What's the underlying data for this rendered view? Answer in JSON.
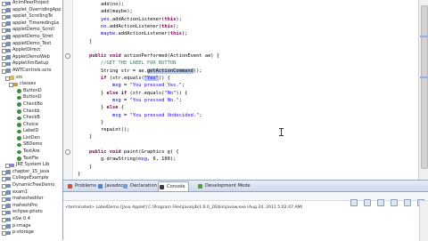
{
  "explorer": {
    "items": [
      {
        "label": "AnimPeerProject",
        "indent": 0,
        "icon": "project"
      },
      {
        "label": "applet_OverridingApp",
        "indent": 0,
        "icon": "project"
      },
      {
        "label": "applet_ScrollingTe",
        "indent": 0,
        "icon": "project"
      },
      {
        "label": "applet_TimeredingLe",
        "indent": 0,
        "icon": "project"
      },
      {
        "label": "appletDemo_Scroll",
        "indent": 0,
        "icon": "project"
      },
      {
        "label": "appletDemo_Stret",
        "indent": 0,
        "icon": "project"
      },
      {
        "label": "appletDemo_Text",
        "indent": 0,
        "icon": "project"
      },
      {
        "label": "AppletDirect",
        "indent": 0,
        "icon": "project"
      },
      {
        "label": "AppletDemoWeb",
        "indent": 0,
        "icon": "project"
      },
      {
        "label": "AppletXmlSetup",
        "indent": 0,
        "icon": "project"
      },
      {
        "label": "AWTControls.scro",
        "indent": 0,
        "icon": "project"
      },
      {
        "label": "src",
        "indent": 1,
        "icon": "folder"
      },
      {
        "label": "classes",
        "indent": 2,
        "icon": "package"
      },
      {
        "label": "ButtonD",
        "indent": 3,
        "icon": "classfile"
      },
      {
        "label": "ButtonD",
        "indent": 3,
        "icon": "classfile"
      },
      {
        "label": "CheckBo",
        "indent": 3,
        "icon": "classfile"
      },
      {
        "label": "Checkb",
        "indent": 3,
        "icon": "classfile"
      },
      {
        "label": "CheckB",
        "indent": 3,
        "icon": "classfile"
      },
      {
        "label": "Choice",
        "indent": 3,
        "icon": "classfile"
      },
      {
        "label": "LabelD",
        "indent": 3,
        "icon": "classfile"
      },
      {
        "label": "ListDen",
        "indent": 3,
        "icon": "classfile"
      },
      {
        "label": "SBDemo",
        "indent": 3,
        "icon": "classfile"
      },
      {
        "label": "TextAre",
        "indent": 3,
        "icon": "classfile"
      },
      {
        "label": "TextFie",
        "indent": 3,
        "icon": "classfile"
      },
      {
        "label": "JRE System Lib",
        "indent": 1,
        "icon": "lib"
      },
      {
        "label": "chapter_15_java",
        "indent": 0,
        "icon": "project"
      },
      {
        "label": "CollegeExample",
        "indent": 0,
        "icon": "project"
      },
      {
        "label": "DynamicTreeDemo",
        "indent": 0,
        "icon": "project"
      },
      {
        "label": "exam1",
        "indent": 0,
        "icon": "project"
      },
      {
        "label": "mahesheditor",
        "indent": 0,
        "icon": "project"
      },
      {
        "label": "maheshPro",
        "indent": 0,
        "icon": "project"
      },
      {
        "label": "eclipse-photo",
        "indent": 0,
        "icon": "project"
      },
      {
        "label": "eSw 0.4",
        "indent": 0,
        "icon": "project"
      },
      {
        "label": "p-image",
        "indent": 0,
        "icon": "project"
      },
      {
        "label": "p-storage",
        "indent": 0,
        "icon": "project"
      }
    ]
  },
  "editor": {
    "lines": [
      {
        "indent": 2,
        "parts": [
          {
            "t": "add(no);",
            "c": ""
          }
        ]
      },
      {
        "indent": 2,
        "parts": [
          {
            "t": "add(maybe);",
            "c": ""
          }
        ]
      },
      {
        "indent": 2,
        "parts": [
          {
            "t": "yes",
            "c": "fld"
          },
          {
            "t": ".addActionListener(",
            "c": ""
          },
          {
            "t": "this",
            "c": "kw"
          },
          {
            "t": ");",
            "c": ""
          }
        ]
      },
      {
        "indent": 2,
        "parts": [
          {
            "t": "no",
            "c": "fld"
          },
          {
            "t": ".addActionListener(",
            "c": ""
          },
          {
            "t": "this",
            "c": "kw"
          },
          {
            "t": ");",
            "c": ""
          }
        ]
      },
      {
        "indent": 2,
        "parts": [
          {
            "t": "maybe",
            "c": "fld"
          },
          {
            "t": ".addActionListener(",
            "c": ""
          },
          {
            "t": "this",
            "c": "kw"
          },
          {
            "t": ");",
            "c": ""
          }
        ]
      },
      {
        "indent": 1,
        "parts": [
          {
            "t": "}",
            "c": ""
          }
        ]
      },
      {
        "indent": 0,
        "parts": []
      },
      {
        "indent": 1,
        "parts": [
          {
            "t": "public void",
            "c": "kw"
          },
          {
            "t": " actionPerformed(ActionEvent ae) {",
            "c": ""
          }
        ]
      },
      {
        "indent": 2,
        "parts": [
          {
            "t": "//GET THE LABEL FOR BUTTON",
            "c": "cmt"
          }
        ]
      },
      {
        "indent": 2,
        "parts": [
          {
            "t": "String str = ae.",
            "c": ""
          },
          {
            "t": "getActionCommand",
            "c": "hl"
          },
          {
            "t": "();",
            "c": ""
          }
        ]
      },
      {
        "indent": 2,
        "parts": [
          {
            "t": "if",
            "c": "kw"
          },
          {
            "t": " (str.equals(",
            "c": ""
          },
          {
            "t": "\"Yes\"",
            "c": "str hl"
          },
          {
            "t": ")) {",
            "c": ""
          }
        ]
      },
      {
        "indent": 3,
        "parts": [
          {
            "t": "msg",
            "c": "fld"
          },
          {
            "t": " = ",
            "c": ""
          },
          {
            "t": "\"You pressed Yes.\"",
            "c": "str"
          },
          {
            "t": ";",
            "c": ""
          }
        ]
      },
      {
        "indent": 2,
        "parts": [
          {
            "t": "} ",
            "c": ""
          },
          {
            "t": "else if",
            "c": "kw"
          },
          {
            "t": " (str.equals(",
            "c": ""
          },
          {
            "t": "\"No\"",
            "c": "str"
          },
          {
            "t": ")) {",
            "c": ""
          }
        ]
      },
      {
        "indent": 3,
        "parts": [
          {
            "t": "msg",
            "c": "fld"
          },
          {
            "t": " = ",
            "c": ""
          },
          {
            "t": "\"You pressed No.\"",
            "c": "str"
          },
          {
            "t": ";",
            "c": ""
          }
        ]
      },
      {
        "indent": 2,
        "parts": [
          {
            "t": "} ",
            "c": ""
          },
          {
            "t": "else",
            "c": "kw"
          },
          {
            "t": " {",
            "c": ""
          }
        ]
      },
      {
        "indent": 3,
        "parts": [
          {
            "t": "msg",
            "c": "fld"
          },
          {
            "t": " = ",
            "c": ""
          },
          {
            "t": "\"You pressed Undecided.\"",
            "c": "str"
          },
          {
            "t": ";",
            "c": ""
          }
        ]
      },
      {
        "indent": 2,
        "parts": [
          {
            "t": "}",
            "c": ""
          }
        ]
      },
      {
        "indent": 2,
        "parts": [
          {
            "t": "repaint();",
            "c": ""
          }
        ]
      },
      {
        "indent": 1,
        "parts": [
          {
            "t": "}",
            "c": ""
          }
        ]
      },
      {
        "indent": 0,
        "parts": []
      },
      {
        "indent": 1,
        "parts": [
          {
            "t": "public void",
            "c": "kw"
          },
          {
            "t": " paint(Graphics g) {",
            "c": ""
          }
        ]
      },
      {
        "indent": 2,
        "parts": [
          {
            "t": "g.drawString(",
            "c": ""
          },
          {
            "t": "msg",
            "c": "fld"
          },
          {
            "t": ", 6, 100);",
            "c": ""
          }
        ]
      },
      {
        "indent": 1,
        "parts": [
          {
            "t": "}",
            "c": ""
          }
        ]
      },
      {
        "indent": 0,
        "parts": [
          {
            "t": "}",
            "c": ""
          }
        ]
      }
    ]
  },
  "bottom_panel": {
    "tabs": [
      {
        "label": "Problems",
        "color": "#d04a3a"
      },
      {
        "label": "Javadoc",
        "color": "#5a7fc8"
      },
      {
        "label": "Declaration",
        "color": "#7a9ad0"
      },
      {
        "label": "Console",
        "color": "#3a3a3a",
        "active": true
      },
      {
        "label": "Development Mode",
        "color": "#5b9a3b"
      }
    ],
    "console_status": "<terminated> LabelDemo [Java Applet] C:\\Program Files\\Java\\jdk1.6.0_26\\bin\\javaw.exe (Aug 24, 2011 5:02:47 AM)"
  },
  "colors": {
    "accent": "#3f7f5f",
    "keyword": "#7f0055",
    "string": "#2a00ff"
  }
}
